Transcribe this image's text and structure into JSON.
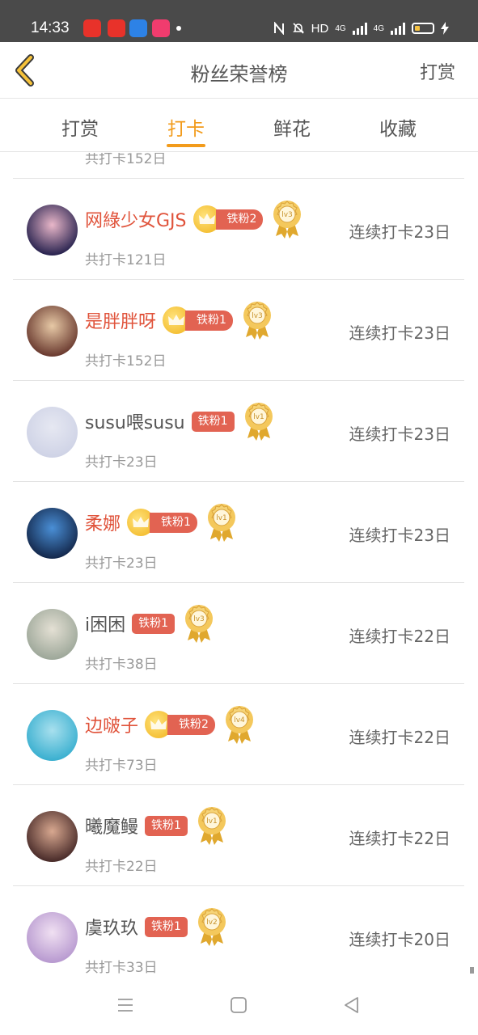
{
  "status_bar": {
    "time": "14:33",
    "network_label": "HD",
    "signal_1": "4G",
    "signal_2": "4G",
    "apps": [
      {
        "icon": "app-red-heart-icon",
        "color": "#e8322a"
      },
      {
        "icon": "app-xiaohongshu-icon",
        "color": "#e8322a"
      },
      {
        "icon": "app-video-icon",
        "color": "#2d82e6"
      },
      {
        "icon": "app-play-icon",
        "color": "#f03c6e"
      }
    ]
  },
  "header": {
    "title": "粉丝荣誉榜",
    "right_action": "打赏",
    "back_icon": "chevron-left-icon"
  },
  "tabs": [
    {
      "label": "打赏",
      "active": false
    },
    {
      "label": "打卡",
      "active": true
    },
    {
      "label": "鲜花",
      "active": false
    },
    {
      "label": "收藏",
      "active": false
    }
  ],
  "partial_row": {
    "total": "共打卡152日"
  },
  "fans": [
    {
      "name": "网綠少女GJS",
      "name_red": true,
      "crown": true,
      "badge": "铁粉2",
      "level": "lv3",
      "total": "共打卡121日",
      "streak": "连续打卡23日",
      "avatar_colors": [
        "#2a2450",
        "#e9b7c9"
      ]
    },
    {
      "name": "是胖胖呀",
      "name_red": true,
      "crown": true,
      "badge": "铁粉1",
      "level": "lv3",
      "total": "共打卡152日",
      "streak": "连续打卡23日",
      "avatar_colors": [
        "#6b3b30",
        "#e7c9a6"
      ]
    },
    {
      "name": "susu喂susu",
      "name_red": false,
      "crown": false,
      "badge": "铁粉1",
      "level": "lv1",
      "total": "共打卡23日",
      "streak": "连续打卡23日",
      "avatar_colors": [
        "#cfd3e6",
        "#e6e8f2"
      ]
    },
    {
      "name": "柔娜",
      "name_red": true,
      "crown": true,
      "badge": "铁粉1",
      "level": "lv1",
      "total": "共打卡23日",
      "streak": "连续打卡23日",
      "avatar_colors": [
        "#14294d",
        "#4a8fd6"
      ]
    },
    {
      "name": "i困困",
      "name_red": false,
      "crown": false,
      "badge": "铁粉1",
      "level": "lv3",
      "total": "共打卡38日",
      "streak": "连续打卡22日",
      "avatar_colors": [
        "#9ea89a",
        "#e4e0d4"
      ]
    },
    {
      "name": "边啵子",
      "name_red": true,
      "crown": true,
      "badge": "铁粉2",
      "level": "lv4",
      "total": "共打卡73日",
      "streak": "连续打卡22日",
      "avatar_colors": [
        "#3bb0d0",
        "#a8e0ee"
      ]
    },
    {
      "name": "曦魔鳗",
      "name_red": false,
      "crown": false,
      "badge": "铁粉1",
      "level": "lv1",
      "total": "共打卡22日",
      "streak": "连续打卡22日",
      "avatar_colors": [
        "#4a2c2a",
        "#d8a890"
      ]
    },
    {
      "name": "虞玖玖",
      "name_red": false,
      "crown": false,
      "badge": "铁粉1",
      "level": "lv2",
      "total": "共打卡33日",
      "streak": "连续打卡20日",
      "avatar_colors": [
        "#b89ad0",
        "#f0e0f2"
      ]
    }
  ],
  "nav": {
    "menu_icon": "menu-icon",
    "home_icon": "home-square-icon",
    "back_icon": "back-triangle-icon"
  },
  "colors": {
    "accent": "#f29b1b",
    "badge_red": "#e26352",
    "name_red": "#e0533b",
    "status_bar_bg": "#4a4a4a"
  }
}
